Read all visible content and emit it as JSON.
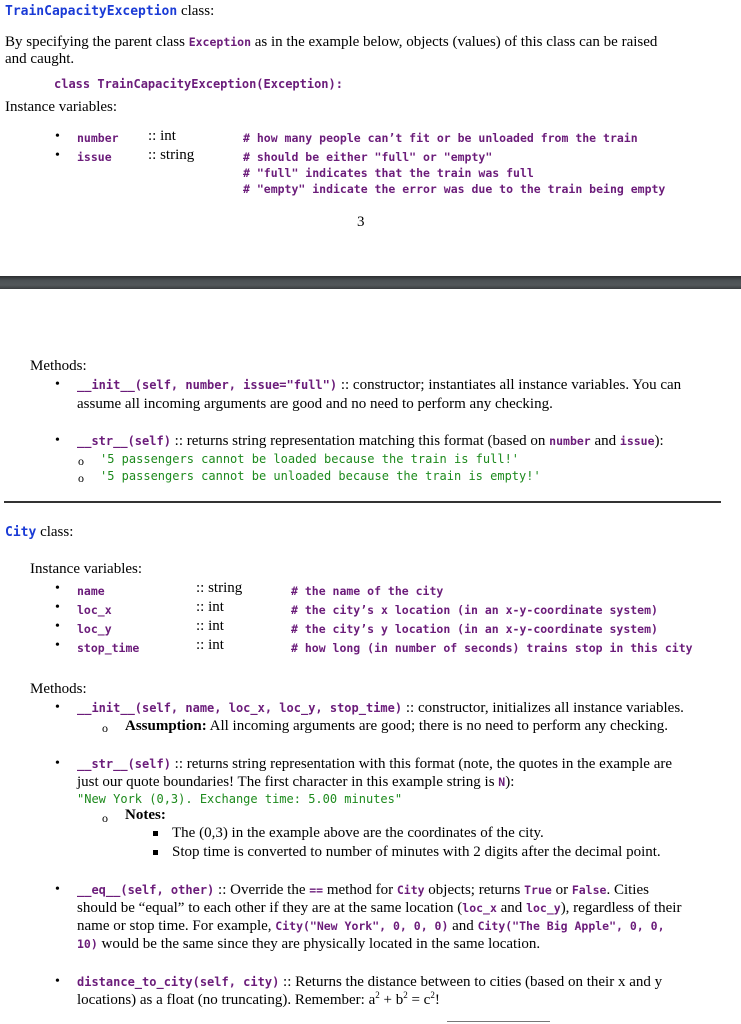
{
  "exception_section": {
    "class_name": "TrainCapacityException",
    "class_suffix": " class:",
    "intro_pre": "By specifying the parent class ",
    "intro_code": "Exception",
    "intro_post": " as in the example below, objects (values) of this class can be raised",
    "intro_line2": "and caught.",
    "declaration": "class TrainCapacityException(Exception):",
    "instance_vars_heading": "Instance variables:",
    "instance_vars": [
      {
        "name": "number",
        "type": ":: int",
        "comment": "# how many people can’t fit or be unloaded from the train"
      },
      {
        "name": "issue",
        "type": ":: string",
        "comment": "# should be either \"full\" or \"empty\""
      }
    ],
    "extra_comments": [
      "# \"full\" indicates that the train was full",
      "# \"empty\" indicate the error was due to the train being empty"
    ],
    "page_number": "3",
    "methods_heading": "Methods:",
    "init_sig": "__init__(self, number, issue=\"full\")",
    "init_desc": " :: constructor; instantiates all instance variables.  You can",
    "init_desc2": "assume all incoming arguments are good and no need to perform any checking.",
    "str_sig": "__str__(self)",
    "str_desc_pre": " :: returns string representation matching this format (based on ",
    "str_code1": "number",
    "str_and": " and ",
    "str_code2": "issue",
    "str_desc_post": "):",
    "str_examples": [
      "'5 passengers cannot be loaded because the train is full!'",
      "'5 passengers cannot be unloaded because the train is empty!'"
    ]
  },
  "city_section": {
    "class_name": "City",
    "class_suffix": " class:",
    "instance_vars_heading": "Instance variables:",
    "instance_vars": [
      {
        "name": "name",
        "type": ":: string",
        "comment": "# the name of the city"
      },
      {
        "name": "loc_x",
        "type": ":: int",
        "comment": "# the city’s x location (in an x-y-coordinate system)"
      },
      {
        "name": "loc_y",
        "type": ":: int",
        "comment": "# the city’s y location (in an x-y-coordinate system)"
      },
      {
        "name": "stop_time",
        "type": ":: int",
        "comment": "# how long (in number of seconds) trains stop in this city"
      }
    ],
    "methods_heading": "Methods:",
    "init_sig": "__init__(self, name, loc_x, loc_y, stop_time)",
    "init_desc": " :: constructor, initializes all instance variables.",
    "assumption_label": "Assumption:",
    "assumption_text": " All incoming arguments are good; there is no need to perform any checking.",
    "str_sig": "__str__(self)",
    "str_desc": " :: returns string representation with this format (note, the quotes in the example are",
    "str_desc2_pre": "just our quote boundaries! The first character in this example string is ",
    "str_desc2_code": "N",
    "str_desc2_post": "):",
    "str_example": "\"New York (0,3). Exchange time: 5.00 minutes\"",
    "notes_label": "Notes:",
    "notes": [
      "The (0,3) in the example above are the coordinates of the city.",
      "Stop time is converted to number of minutes with 2 digits after the decimal point."
    ],
    "eq_sig": "__eq__(self, other)",
    "eq_t1": " :: Override the ",
    "eq_c1": "==",
    "eq_t2": " method for ",
    "eq_c2": "City",
    "eq_t3": " objects; returns ",
    "eq_c3": "True",
    "eq_t4": " or ",
    "eq_c4": "False",
    "eq_t5": ". Cities",
    "eq_l2_t1": "should be “equal” to each other if they are at the same location (",
    "eq_l2_c1": "loc_x",
    "eq_l2_t2": " and ",
    "eq_l2_c2": "loc_y",
    "eq_l2_t3": "), regardless of their",
    "eq_l3_t1": "name or stop time. For example, ",
    "eq_l3_c1": "City(\"New York\", 0, 0, 0)",
    "eq_l3_t2": " and ",
    "eq_l3_c2": "City(\"The Big Apple\", 0, 0,",
    "eq_l4_c1": "10)",
    "eq_l4_t1": " would be the same since they are physically located in the same location.",
    "dist_sig": "distance_to_city(self, city)",
    "dist_desc": " :: Returns the distance between to cities (based on their x and y",
    "dist_desc2_pre": "locations) as a float (no truncating). Remember: a",
    "dist_sup": "2",
    "dist_plus": " + b",
    "dist_eq": " = c",
    "dist_end": "!"
  }
}
